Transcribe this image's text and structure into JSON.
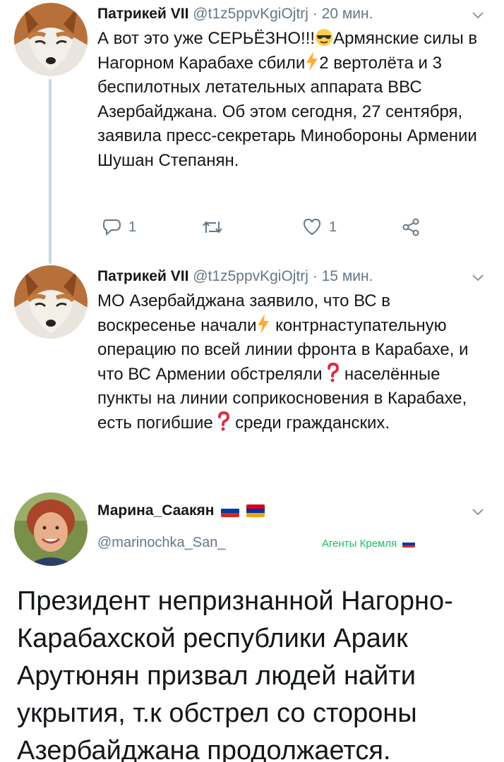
{
  "tweets": [
    {
      "author": "Патрикей VII",
      "handle": "@t1z5ppvKgiOjtrj",
      "time": "· 20 мин.",
      "text_part1": "А вот это уже СЕРЬЁЗНО!!!",
      "text_part2": "Армянские силы в Нагорном Карабахе сбили",
      "text_part3": "2 вертолёта и 3 беспилотных летательных аппарата ВВС Азербайджана. Об этом сегодня, 27 сентября, заявила пресс-секретарь Минобороны Армении Шушан Степанян.",
      "reply_count": "1",
      "like_count": "1"
    },
    {
      "author": "Патрикей VII",
      "handle": "@t1z5ppvKgiOjtrj",
      "time": "· 15 мин.",
      "text_part1": "МО Азербайджана заявило, что ВС в воскресенье начали",
      "text_part2": "контрнаступательную операцию по всей линии фронта в Карабахе, и что ВС Армении обстреляли",
      "text_part3": "населённые пункты на линии соприкосновения в Карабахе, есть погибшие",
      "text_part4": "среди гражданских."
    }
  ],
  "embedded_profile": {
    "name": "Марина_Саакян",
    "handle": "@marinochka_San_",
    "label": "Агенты Кремля"
  },
  "caption": "Президент непризнанной Нагорно-Карабахской республики Араик Арутюнян призвал людей найти укрытия, т.к обстрел со стороны Азербайджана продолжается.",
  "colors": {
    "text": "#14171a",
    "secondary": "#657786",
    "thread_line": "#ccd6dd",
    "label_green": "#17bf63",
    "bolt": "#ffac33",
    "question": "#dd2e44"
  }
}
